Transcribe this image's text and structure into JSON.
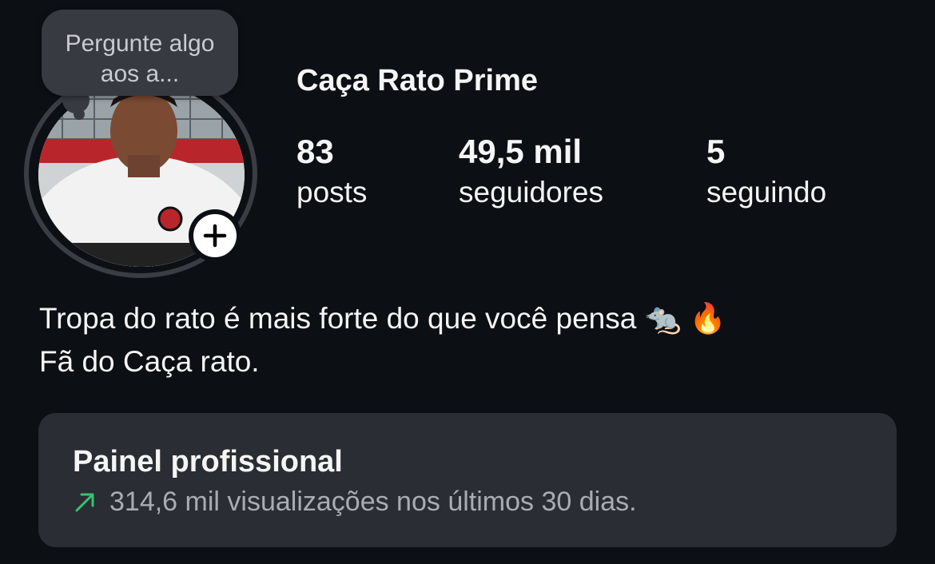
{
  "profile": {
    "username": "Caça Rato Prime",
    "avatar_alt": "profile-photo",
    "add_icon": "plus-icon"
  },
  "note_bubble": {
    "text": "Pergunte algo aos a..."
  },
  "stats": [
    {
      "value": "83",
      "label": "posts"
    },
    {
      "value": "49,5 mil",
      "label": "seguidores"
    },
    {
      "value": "5",
      "label": "seguindo"
    }
  ],
  "bio": {
    "line1": "Tropa do rato é mais forte do que você pensa 🐀 🔥",
    "line2": "Fã do Caça rato."
  },
  "professional_panel": {
    "title": "Painel profissional",
    "subtitle": "314,6 mil visualizações nos últimos 30 dias.",
    "trend_icon": "trending-up-arrow-icon",
    "trend_color": "#37c26f"
  },
  "colors": {
    "background": "#0c0f14",
    "panel": "#2a2d33",
    "bubble": "#373a41"
  }
}
